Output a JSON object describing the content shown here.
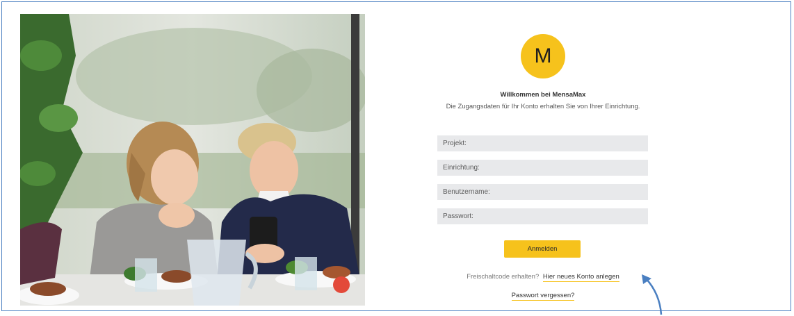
{
  "logo": {
    "letter": "M"
  },
  "welcome": {
    "title": "Willkommen bei MensaMax",
    "subtitle": "Die Zugangsdaten für Ihr Konto erhalten Sie von Ihrer Einrichtung."
  },
  "form": {
    "project_placeholder": "Projekt:",
    "institution_placeholder": "Einrichtung:",
    "username_placeholder": "Benutzername:",
    "password_placeholder": "Passwort:",
    "submit_label": "Anmelden"
  },
  "links": {
    "unlock_prompt": "Freischaltcode erhalten?",
    "register_label": "Hier neues Konto anlegen",
    "forgot_label": "Passwort vergessen?"
  },
  "colors": {
    "accent": "#f6c21c",
    "field_bg": "#e8e9eb",
    "annotation_arrow": "#4a7fc1",
    "frame_border": "#4a7fc1"
  },
  "icons": {
    "photo": "cafeteria-photo",
    "arrow": "annotation-arrow-icon"
  }
}
